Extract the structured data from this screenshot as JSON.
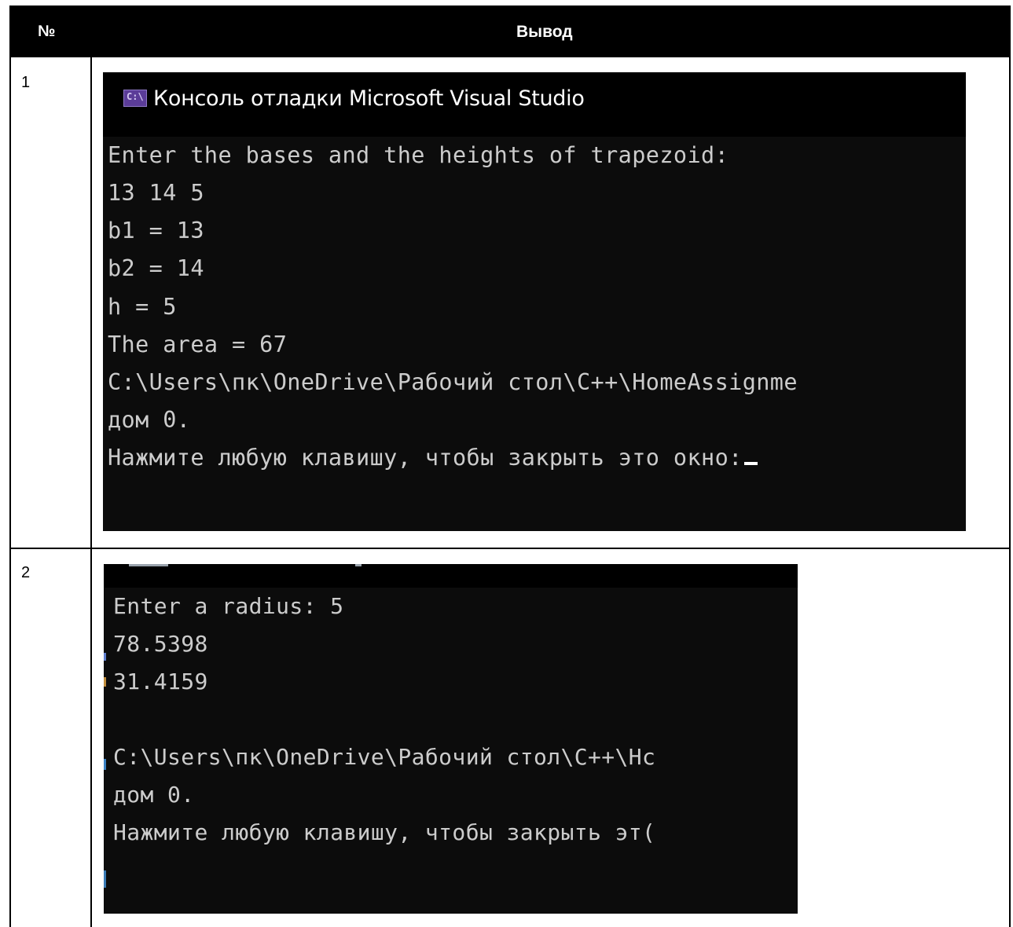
{
  "table": {
    "headers": {
      "number": "№",
      "output": "Вывод"
    },
    "rows": [
      {
        "number": "1",
        "console": {
          "title": "Консоль отладки Microsoft Visual Studio",
          "icon": "console-app-icon",
          "icon_text": "C:\\",
          "lines": [
            "Enter the bases and the heights of trapezoid:",
            "13 14 5",
            "b1 = 13",
            "b2 = 14",
            "h = 5",
            "The area = 67",
            "C:\\Users\\пк\\OneDrive\\Рабочий стол\\C++\\HomeAssignme",
            "дом 0.",
            "Нажмите любую клавишу, чтобы закрыть это окно:"
          ]
        }
      },
      {
        "number": "2",
        "console": {
          "lines": [
            "Enter a radius: 5",
            "78.5398",
            "31.4159",
            "",
            "C:\\Users\\пк\\OneDrive\\Рабочий стол\\C++\\Hc",
            "дом 0.",
            "Нажмите любую клавишу, чтобы закрыть эт("
          ]
        }
      }
    ]
  },
  "colors": {
    "console_bg": "#0c0c0c",
    "console_text": "#cccccc",
    "header_bg": "#000000"
  }
}
